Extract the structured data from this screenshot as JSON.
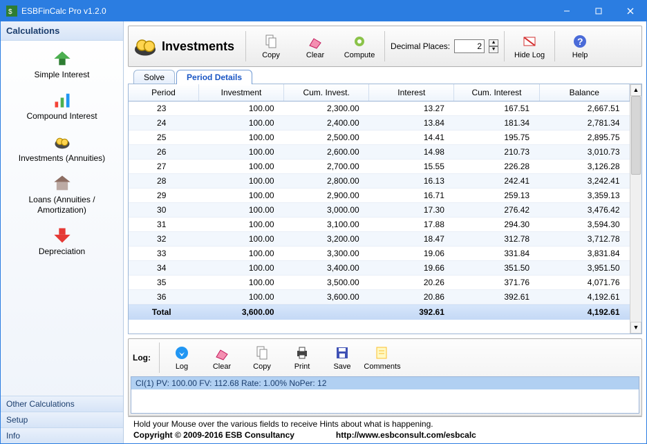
{
  "window": {
    "title": "ESBFinCalc Pro v1.2.0"
  },
  "sidebar": {
    "title": "Calculations",
    "items": [
      {
        "label": "Simple Interest"
      },
      {
        "label": "Compound Interest"
      },
      {
        "label": "Investments (Annuities)"
      },
      {
        "label": "Loans (Annuities / Amortization)"
      },
      {
        "label": "Depreciation"
      }
    ],
    "links": [
      {
        "label": "Other Calculations"
      },
      {
        "label": "Setup"
      },
      {
        "label": "Info"
      }
    ]
  },
  "panel": {
    "title": "Investments",
    "buttons": {
      "copy": "Copy",
      "clear": "Clear",
      "compute": "Compute",
      "hidelog": "Hide Log",
      "help": "Help"
    },
    "decimal_label": "Decimal Places:",
    "decimal_value": "2"
  },
  "tabs": {
    "solve": "Solve",
    "period": "Period Details"
  },
  "table": {
    "headers": [
      "Period",
      "Investment",
      "Cum. Invest.",
      "Interest",
      "Cum. Interest",
      "Balance"
    ],
    "rows": [
      [
        "23",
        "100.00",
        "2,300.00",
        "13.27",
        "167.51",
        "2,667.51"
      ],
      [
        "24",
        "100.00",
        "2,400.00",
        "13.84",
        "181.34",
        "2,781.34"
      ],
      [
        "25",
        "100.00",
        "2,500.00",
        "14.41",
        "195.75",
        "2,895.75"
      ],
      [
        "26",
        "100.00",
        "2,600.00",
        "14.98",
        "210.73",
        "3,010.73"
      ],
      [
        "27",
        "100.00",
        "2,700.00",
        "15.55",
        "226.28",
        "3,126.28"
      ],
      [
        "28",
        "100.00",
        "2,800.00",
        "16.13",
        "242.41",
        "3,242.41"
      ],
      [
        "29",
        "100.00",
        "2,900.00",
        "16.71",
        "259.13",
        "3,359.13"
      ],
      [
        "30",
        "100.00",
        "3,000.00",
        "17.30",
        "276.42",
        "3,476.42"
      ],
      [
        "31",
        "100.00",
        "3,100.00",
        "17.88",
        "294.30",
        "3,594.30"
      ],
      [
        "32",
        "100.00",
        "3,200.00",
        "18.47",
        "312.78",
        "3,712.78"
      ],
      [
        "33",
        "100.00",
        "3,300.00",
        "19.06",
        "331.84",
        "3,831.84"
      ],
      [
        "34",
        "100.00",
        "3,400.00",
        "19.66",
        "351.50",
        "3,951.50"
      ],
      [
        "35",
        "100.00",
        "3,500.00",
        "20.26",
        "371.76",
        "4,071.76"
      ],
      [
        "36",
        "100.00",
        "3,600.00",
        "20.86",
        "392.61",
        "4,192.61"
      ]
    ],
    "footer": [
      "Total",
      "3,600.00",
      "",
      "392.61",
      "",
      "4,192.61"
    ]
  },
  "log": {
    "label": "Log:",
    "buttons": {
      "log": "Log",
      "clear": "Clear",
      "copy": "Copy",
      "print": "Print",
      "save": "Save",
      "comments": "Comments"
    },
    "entry": "CI(1) PV: 100.00 FV: 112.68 Rate: 1.00% NoPer: 12"
  },
  "status": {
    "hint": "Hold your Mouse over the various fields to receive Hints about what is happening.",
    "copyright": "Copyright © 2009-2016 ESB Consultancy",
    "url": "http://www.esbconsult.com/esbcalc"
  }
}
